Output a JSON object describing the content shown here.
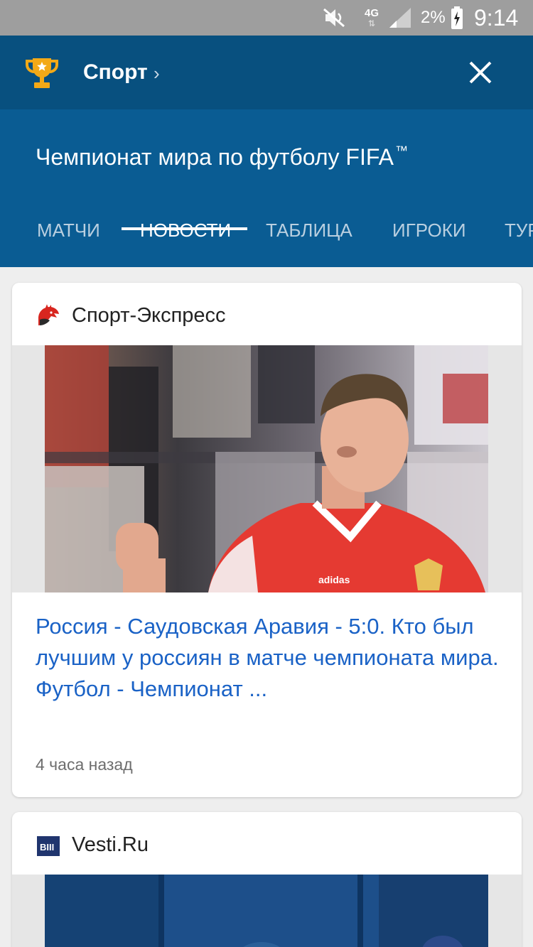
{
  "status_bar": {
    "network": "4G",
    "battery": "2%",
    "time": "9:14"
  },
  "header": {
    "category": "Спорт",
    "league_title": "Чемпионат мира по футболу FIFA",
    "trademark": "™",
    "tabs": [
      {
        "label": "МАТЧИ",
        "active": false
      },
      {
        "label": "НОВОСТИ",
        "active": true
      },
      {
        "label": "ТАБЛИЦА",
        "active": false
      },
      {
        "label": "ИГРОКИ",
        "active": false
      },
      {
        "label": "ТУРНИР",
        "active": false
      }
    ]
  },
  "feed": [
    {
      "source": "Спорт-Экспресс",
      "headline": "Россия - Саудовская Аравия - 5:0. Кто был лучшим у россиян в матче чемпионата мира. Футбол - Чемпионат ...",
      "time_ago": "4 часа назад"
    },
    {
      "source": "Vesti.Ru",
      "logo_text": "BIII"
    }
  ],
  "colors": {
    "topbar": "#08507f",
    "header": "#0a5c93",
    "headline": "#1a62c6",
    "trophy": "#f3a917"
  }
}
